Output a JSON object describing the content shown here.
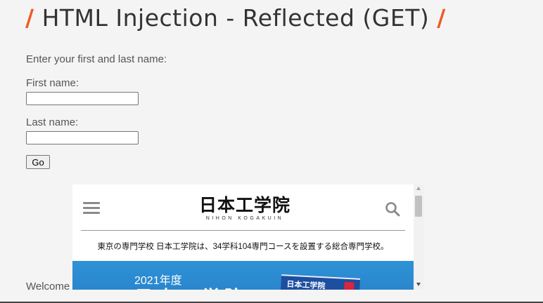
{
  "page": {
    "title": "HTML Injection - Reflected (GET)",
    "title_slash": "/",
    "accent_color": "#ef5a24"
  },
  "form": {
    "prompt": "Enter your first and last name:",
    "first_name_label": "First name:",
    "first_name_value": "",
    "last_name_label": "Last name:",
    "last_name_value": "",
    "submit_label": "Go"
  },
  "result": {
    "welcome_text": "Welcome"
  },
  "embedded_site": {
    "menu_icon": "hamburger-menu-icon",
    "logo_text": "日本工学院",
    "logo_subtext": "NIHON KOGAKUIN",
    "search_icon": "magnifier-icon",
    "tagline": "東京の専門学校 日本工学院は、34学科104専門コースを設置する総合専門学校。",
    "banner_year": "2021年度",
    "banner_big_text": "日本工学院",
    "book_label": "日本工学院",
    "banner_color": "#2f92d6"
  }
}
